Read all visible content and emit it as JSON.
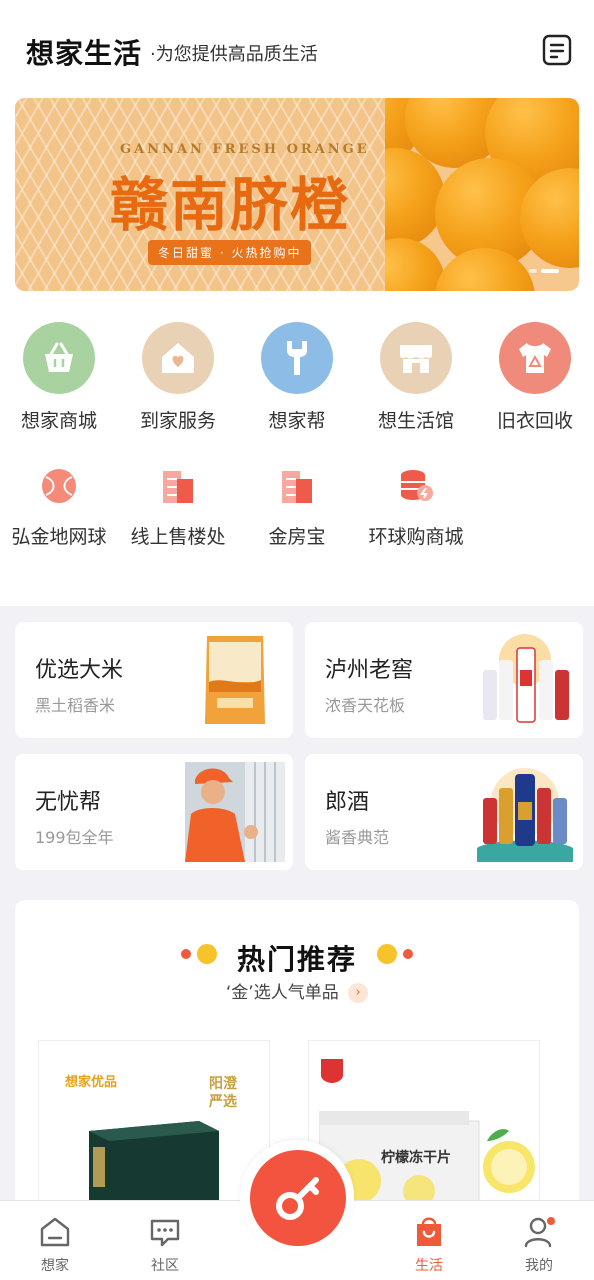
{
  "header": {
    "brand": "想家生活",
    "slogan": "·为您提供高品质生活",
    "doc_icon": "document-icon"
  },
  "banner": {
    "subtitle_en": "GANNAN FRESH ORANGE",
    "title": "赣南脐橙",
    "tagline": "冬日甜蜜 · 火热抢购中"
  },
  "quick_row1": [
    {
      "label": "想家商城",
      "icon": "basket-icon",
      "color": "#a8d3a0"
    },
    {
      "label": "到家服务",
      "icon": "house-heart-icon",
      "color": "#e9d1b5"
    },
    {
      "label": "想家帮",
      "icon": "wrench-icon",
      "color": "#8dbde6"
    },
    {
      "label": "想生活馆",
      "icon": "store-icon",
      "color": "#e9d1b5"
    },
    {
      "label": "旧衣回收",
      "icon": "tshirt-recycle-icon",
      "color": "#f08a7a"
    }
  ],
  "quick_row2": [
    {
      "label": "弘金地网球",
      "icon": "tennis-ball-icon"
    },
    {
      "label": "线上售楼处",
      "icon": "building-icon"
    },
    {
      "label": "金房宝",
      "icon": "building-icon"
    },
    {
      "label": "环球购商城",
      "icon": "coins-icon"
    }
  ],
  "cards": [
    {
      "title": "优选大米",
      "sub": "黑土稻香米"
    },
    {
      "title": "泸州老窖",
      "sub": "浓香天花板"
    },
    {
      "title": "无忧帮",
      "sub": "199包全年"
    },
    {
      "title": "郎酒",
      "sub": "酱香典范"
    }
  ],
  "hot": {
    "title": "热门推荐",
    "subtitle": "‘金’选人气单品",
    "products": [
      {
        "brand": "想家优品",
        "tag": "阳澄严选"
      },
      {
        "tag": "柠檬冻干片"
      }
    ]
  },
  "nav": {
    "items": [
      {
        "label": "想家",
        "icon": "home-icon"
      },
      {
        "label": "社区",
        "icon": "chat-icon"
      },
      {
        "label": "生活",
        "icon": "shopping-bag-icon",
        "active": true
      },
      {
        "label": "我的",
        "icon": "user-icon"
      }
    ],
    "fab_icon": "key-icon"
  },
  "colors": {
    "accent": "#ef5a3a",
    "gray_bg": "#f1f1f6"
  }
}
